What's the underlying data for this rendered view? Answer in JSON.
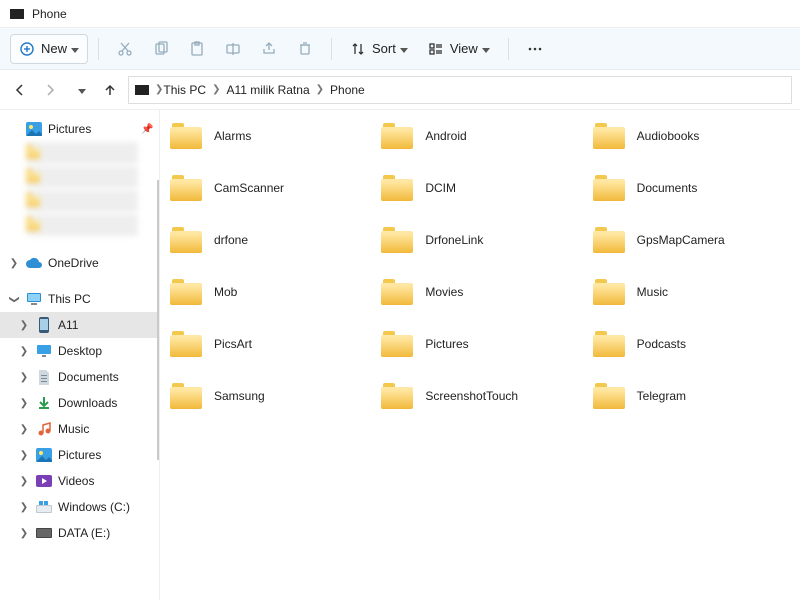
{
  "title": "Phone",
  "toolbar": {
    "new_label": "New",
    "sort_label": "Sort",
    "view_label": "View"
  },
  "breadcrumb": {
    "items": [
      "This PC",
      "A11 milik Ratna",
      "Phone"
    ]
  },
  "sidebar": {
    "pictures_label": "Pictures",
    "onedrive_label": "OneDrive",
    "thispc_label": "This PC",
    "items": [
      {
        "label": "A11"
      },
      {
        "label": "Desktop"
      },
      {
        "label": "Documents"
      },
      {
        "label": "Downloads"
      },
      {
        "label": "Music"
      },
      {
        "label": "Pictures"
      },
      {
        "label": "Videos"
      },
      {
        "label": "Windows (C:)"
      },
      {
        "label": "DATA (E:)"
      }
    ]
  },
  "folders": [
    "Alarms",
    "Android",
    "Audiobooks",
    "CamScanner",
    "DCIM",
    "Documents",
    "drfone",
    "DrfoneLink",
    "GpsMapCamera",
    "Mob",
    "Movies",
    "Music",
    "PicsArt",
    "Pictures",
    "Podcasts",
    "Samsung",
    "ScreenshotTouch",
    "Telegram"
  ]
}
